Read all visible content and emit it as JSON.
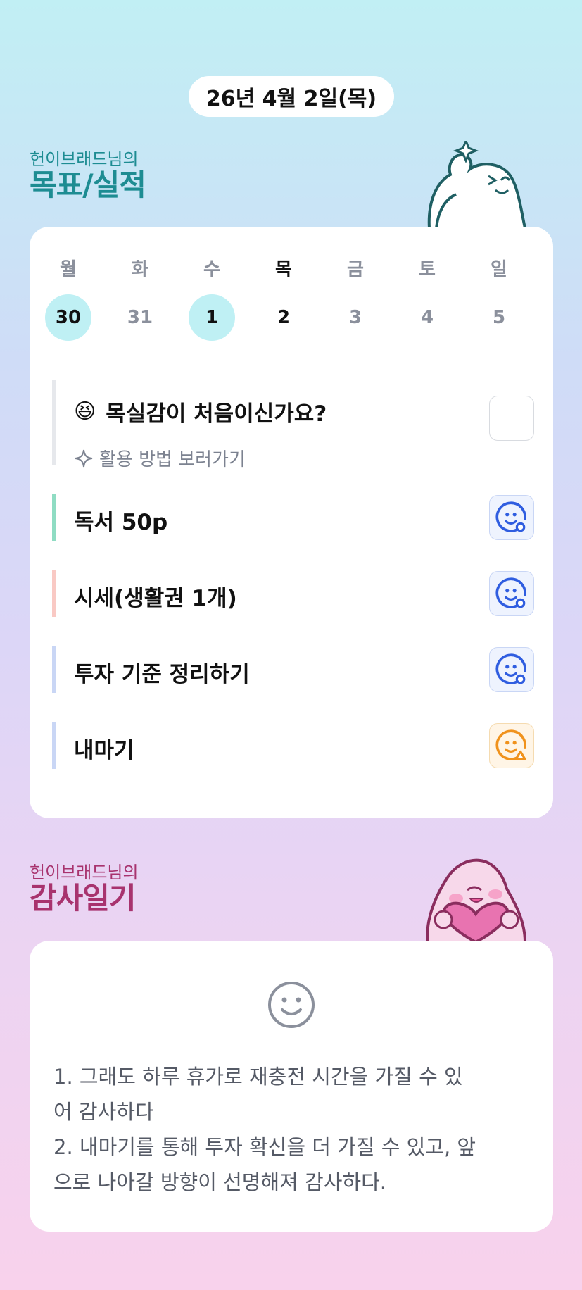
{
  "date_label": "26년 4월 2일(목)",
  "goals_section": {
    "owner": "헌이브래드님의",
    "title": "목표/실적"
  },
  "week": [
    {
      "day": "월",
      "date": "30",
      "marked": true,
      "today": false
    },
    {
      "day": "화",
      "date": "31",
      "marked": false,
      "today": false
    },
    {
      "day": "수",
      "date": "1",
      "marked": true,
      "today": false
    },
    {
      "day": "목",
      "date": "2",
      "marked": false,
      "today": true
    },
    {
      "day": "금",
      "date": "3",
      "marked": false,
      "today": false
    },
    {
      "day": "토",
      "date": "4",
      "marked": false,
      "today": false
    },
    {
      "day": "일",
      "date": "5",
      "marked": false,
      "today": false
    }
  ],
  "intro_goal": {
    "emoji": "😆",
    "title": "목실감이 처음이신가요?",
    "link": "활용 방법 보러가기"
  },
  "goals": [
    {
      "title": "독서 50p",
      "color": "#8fdcc3",
      "status": "blue"
    },
    {
      "title": "시세(생활권 1개)",
      "color": "#f9c9c4",
      "status": "blue"
    },
    {
      "title": "투자 기준 정리하기",
      "color": "#c9d6f5",
      "status": "blue"
    },
    {
      "title": "내마기",
      "color": "#c9d6f5",
      "status": "orange"
    }
  ],
  "gratitude_section": {
    "owner": "헌이브래드님의",
    "title": "감사일기"
  },
  "gratitude_text": "1. 그래도 하루 휴가로 재충전 시간을 가질 수 있\n어 감사하다\n2. 내마기를 통해 투자 확신을 더 가질 수 있고, 앞\n으로 나아갈 방향이 선명해져 감사하다.",
  "colors": {
    "accent_blue": "#2f5de0",
    "accent_orange": "#f0921c",
    "teal": "#1d8c92",
    "magenta": "#a8336e"
  }
}
